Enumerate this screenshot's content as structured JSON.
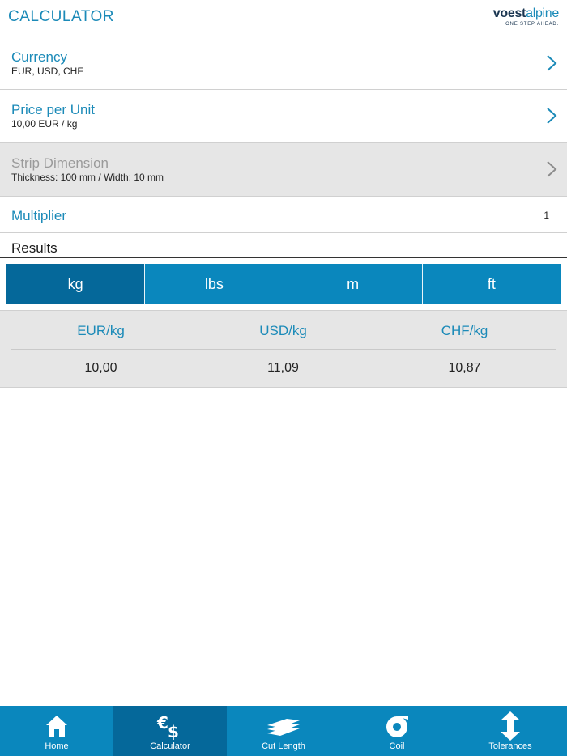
{
  "header": {
    "title": "CALCULATOR",
    "logo_brand_a": "voest",
    "logo_brand_b": "alpine",
    "logo_slogan": "ONE STEP AHEAD."
  },
  "rows": {
    "currency": {
      "label": "Currency",
      "value": "EUR, USD, CHF"
    },
    "price": {
      "label": "Price per Unit",
      "value": "10,00  EUR / kg"
    },
    "strip": {
      "label": "Strip Dimension",
      "value": "Thickness: 100 mm / Width: 10 mm"
    },
    "multiplier": {
      "label": "Multiplier",
      "value": "1"
    }
  },
  "results": {
    "title": "Results",
    "units": [
      "kg",
      "lbs",
      "m",
      "ft"
    ],
    "selected_unit": "kg",
    "columns": [
      {
        "header": "EUR/kg",
        "value": "10,00"
      },
      {
        "header": "USD/kg",
        "value": "11,09"
      },
      {
        "header": "CHF/kg",
        "value": "10,87"
      }
    ]
  },
  "tabs": [
    {
      "label": "Home",
      "icon": "home-icon"
    },
    {
      "label": "Calculator",
      "icon": "calculator-icon"
    },
    {
      "label": "Cut Length",
      "icon": "cut-length-icon"
    },
    {
      "label": "Coil",
      "icon": "coil-icon"
    },
    {
      "label": "Tolerances",
      "icon": "tolerances-icon"
    }
  ],
  "active_tab": "Calculator",
  "colors": {
    "accent": "#1b8ab8",
    "bar": "#0a87bd",
    "bar_active": "#05689a",
    "disabled_bg": "#e6e6e6"
  }
}
